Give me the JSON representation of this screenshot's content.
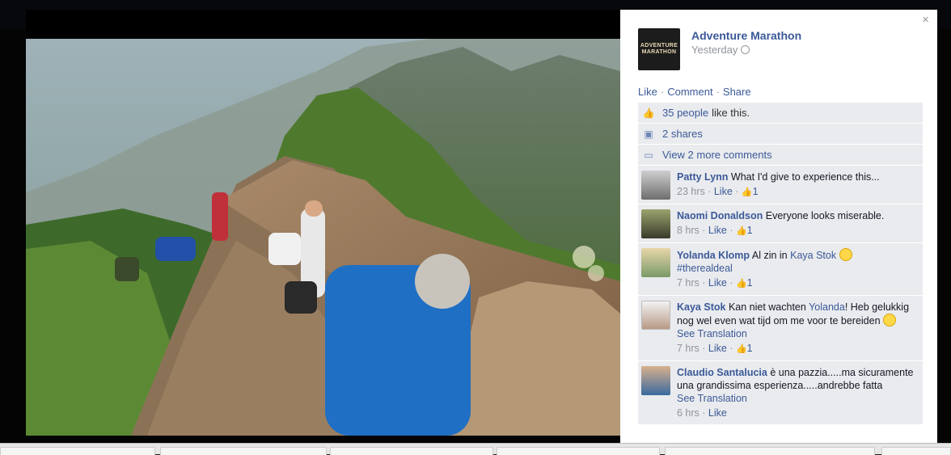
{
  "page": {
    "name": "Adventure Marathon",
    "logo_line1": "ADVENTURE",
    "logo_line2": "MARATHON",
    "time": "Yesterday",
    "close_symbol": "×"
  },
  "actions": {
    "like": "Like",
    "comment": "Comment",
    "share": "Share",
    "separator": "·"
  },
  "ufi": {
    "likes_link": "35 people",
    "likes_rest": "like this.",
    "shares": "2 shares",
    "more_comments": "View 2 more comments"
  },
  "comments": [
    {
      "name": "Patty Lynn",
      "text": "What I'd give to experience this...",
      "time": "23 hrs",
      "like": "Like",
      "count": "1"
    },
    {
      "name": "Naomi Donaldson",
      "text": "Everyone looks miserable.",
      "time": "8 hrs",
      "like": "Like",
      "count": "1"
    },
    {
      "name": "Yolanda Klomp",
      "text": "Al zin in",
      "mention": "Kaya Stok",
      "tag": "#therealdeal",
      "time": "7 hrs",
      "like": "Like",
      "count": "1"
    },
    {
      "name": "Kaya Stok",
      "text": "Kan niet wachten",
      "mention": "Yolanda",
      "text2": "! Heb gelukkig nog wel even wat tijd om me voor te bereiden",
      "see_translation": "See Translation",
      "time": "7 hrs",
      "like": "Like",
      "count": "1"
    },
    {
      "name": "Claudio Santalucia",
      "text": "è una pazzia.....ma sicuramente una grandissima esperienza.....andrebbe fatta",
      "see_translation": "See Translation",
      "time": "6 hrs",
      "like": "Like"
    }
  ],
  "colors": {
    "link": "#3b5998",
    "panel_bg": "#e9ebee",
    "muted": "#90949c"
  },
  "icons": [
    "close-icon",
    "globe-icon",
    "thumbs-up-icon",
    "share-icon",
    "comment-icon",
    "smiley-icon"
  ]
}
